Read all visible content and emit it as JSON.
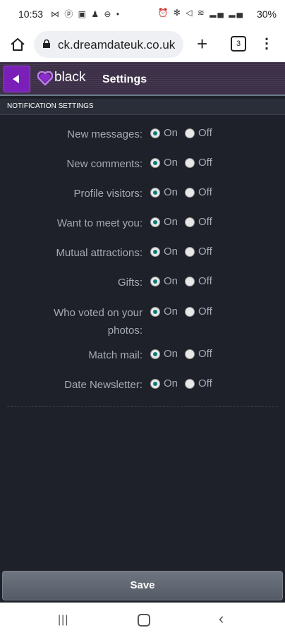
{
  "status_bar": {
    "time": "10:53",
    "battery": "30%",
    "left_icons": "⋈ ⓟ ▣ ♟ ⊖ •",
    "right_icons": "⏰ ✻ ◁ ≋ ▂▄ ▂▄"
  },
  "browser": {
    "url": "ck.dreamdateuk.co.uk",
    "tab_count": "3"
  },
  "app_header": {
    "logo_text": "black",
    "title": "Settings",
    "accent_color": "#7a1fb8"
  },
  "section": {
    "title": "NOTIFICATION SETTINGS"
  },
  "options": {
    "on_label": "On",
    "off_label": "Off"
  },
  "settings": [
    {
      "label": "New messages:",
      "value": "On"
    },
    {
      "label": "New comments:",
      "value": "On"
    },
    {
      "label": "Profile visitors:",
      "value": "On"
    },
    {
      "label": "Want to meet you:",
      "value": "On"
    },
    {
      "label": "Mutual attractions:",
      "value": "On"
    },
    {
      "label": "Gifts:",
      "value": "On"
    },
    {
      "label_line1": "Who voted on your",
      "label_line2": "photos:",
      "value": "On"
    },
    {
      "label": "Match mail:",
      "value": "On"
    },
    {
      "label": "Date Newsletter:",
      "value": "On"
    }
  ],
  "save_label": "Save"
}
